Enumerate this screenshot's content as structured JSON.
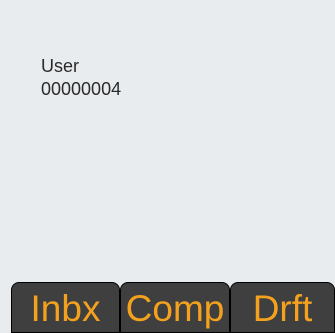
{
  "account": {
    "label": "User",
    "number": "00000004"
  },
  "tabs": [
    {
      "label": "Inbx"
    },
    {
      "label": "Comp"
    },
    {
      "label": "Drft"
    }
  ],
  "colors": {
    "background": "#e9ecef",
    "tab_background": "#3f3f3f",
    "tab_text": "#f4a21d",
    "body_text": "#2a2a2a"
  }
}
